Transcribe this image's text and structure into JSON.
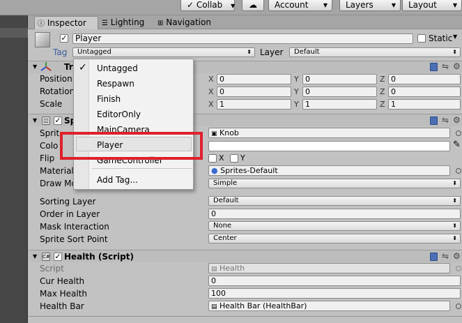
{
  "toolbar": {
    "collab_label": "Collab",
    "cloud_icon": "cloud-icon",
    "account_label": "Account",
    "layers_label": "Layers",
    "layout_label": "Layout"
  },
  "tabs": {
    "inspector": "Inspector",
    "lighting": "Lighting",
    "navigation": "Navigation"
  },
  "object": {
    "name": "Player",
    "static_label": "Static",
    "tag_label": "Tag",
    "tag_value": "Untagged",
    "layer_label": "Layer",
    "layer_value": "Default"
  },
  "transform": {
    "title": "Tr",
    "position_label": "Position",
    "rotation_label": "Rotation",
    "scale_label": "Scale",
    "position": {
      "x": "0",
      "y": "0",
      "z": "0"
    },
    "rotation": {
      "x": "0",
      "y": "0",
      "z": "0"
    },
    "scale": {
      "x": "1",
      "y": "1",
      "z": "1"
    },
    "axis": {
      "x": "X",
      "y": "Y",
      "z": "Z"
    }
  },
  "sprite_renderer": {
    "title": "Sp",
    "sprite_label": "Sprit",
    "sprite_value": "Knob",
    "color_label": "Colo",
    "flip_label": "Flip",
    "flip_x": "X",
    "flip_y": "Y",
    "material_label": "Material",
    "material_value": "Sprites-Default",
    "draw_mode_label": "Draw Mo",
    "draw_mode_value": "Simple",
    "sorting_layer_label": "Sorting Layer",
    "sorting_layer_value": "Default",
    "order_label": "Order in Layer",
    "order_value": "0",
    "mask_label": "Mask Interaction",
    "mask_value": "None",
    "sort_point_label": "Sprite Sort Point",
    "sort_point_value": "Center"
  },
  "health": {
    "title": "Health (Script)",
    "script_label": "Script",
    "script_value": "Health",
    "cur_label": "Cur Health",
    "cur_value": "0",
    "max_label": "Max Health",
    "max_value": "100",
    "bar_label": "Health Bar",
    "bar_value": "Health Bar (HealthBar)"
  },
  "tag_popup": {
    "checkmark": "✓",
    "items": [
      "Untagged",
      "Respawn",
      "Finish",
      "EditorOnly",
      "MainCamera",
      "Player",
      "GameController"
    ],
    "add_tag": "Add Tag..."
  },
  "colors": {
    "highlight": "#e0202c",
    "selected_item": "#e4e4e4"
  }
}
